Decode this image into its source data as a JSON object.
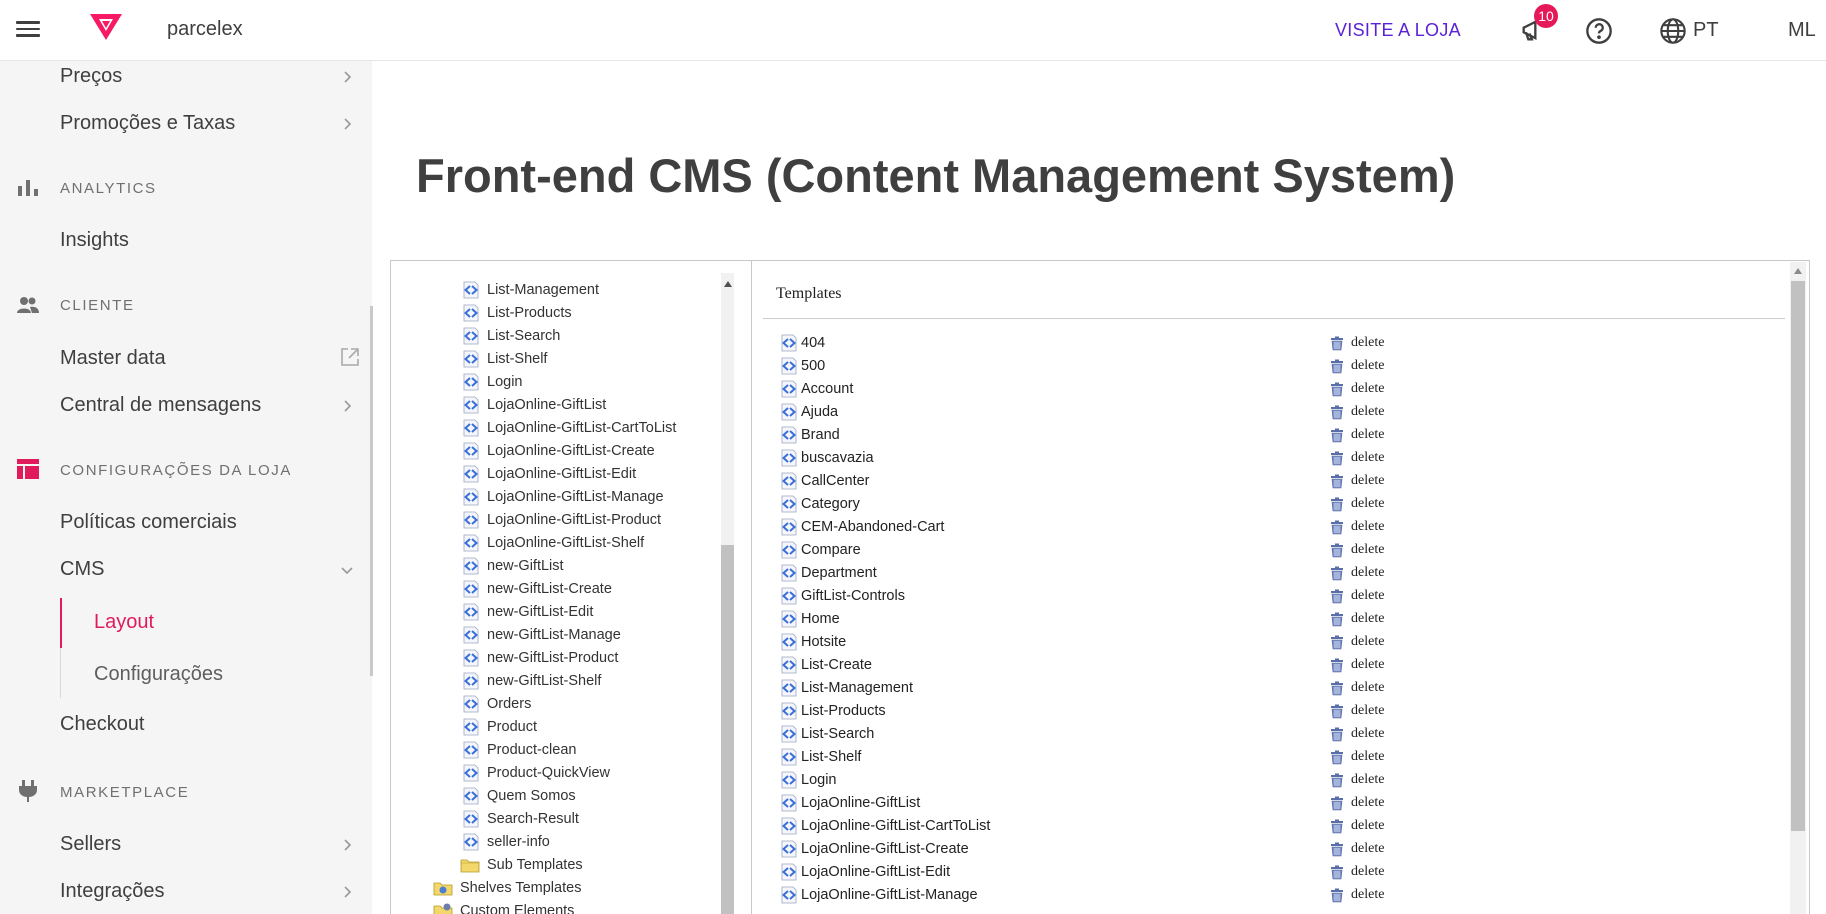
{
  "topbar": {
    "store_name": "parcelex",
    "visit_label": "VISITE A LOJA",
    "notification_count": "10",
    "language": "PT",
    "user_initials": "ML",
    "brand_color": "#f71963",
    "link_color": "#5a21d6"
  },
  "sidebar": {
    "items_top": [
      {
        "label": "Preços"
      },
      {
        "label": "Promoções e Taxas"
      }
    ],
    "sections": {
      "analytics": {
        "title": "ANALYTICS",
        "items": [
          "Insights"
        ]
      },
      "cliente": {
        "title": "CLIENTE",
        "items": [
          "Master data",
          "Central de mensagens"
        ]
      },
      "config": {
        "title": "CONFIGURAÇÕES DA LOJA",
        "items": [
          "Políticas comerciais",
          "CMS",
          "Checkout"
        ],
        "sub": [
          "Layout",
          "Configurações"
        ]
      },
      "marketplace": {
        "title": "MARKETPLACE",
        "items": [
          "Sellers",
          "Integrações"
        ]
      }
    },
    "active_color": "#e11a5c"
  },
  "main": {
    "title": "Front-end CMS (Content Management System)"
  },
  "tree": {
    "items": [
      "List-Management",
      "List-Products",
      "List-Search",
      "List-Shelf",
      "Login",
      "LojaOnline-GiftList",
      "LojaOnline-GiftList-CartToList",
      "LojaOnline-GiftList-Create",
      "LojaOnline-GiftList-Edit",
      "LojaOnline-GiftList-Manage",
      "LojaOnline-GiftList-Product",
      "LojaOnline-GiftList-Shelf",
      "new-GiftList",
      "new-GiftList-Create",
      "new-GiftList-Edit",
      "new-GiftList-Manage",
      "new-GiftList-Product",
      "new-GiftList-Shelf",
      "Orders",
      "Product",
      "Product-clean",
      "Product-QuickView",
      "Quem Somos",
      "Search-Result",
      "seller-info"
    ],
    "sub_templates": "Sub Templates",
    "shelves_templates": "Shelves Templates",
    "custom_elements": "Custom Elements"
  },
  "templates": {
    "header": "Templates",
    "delete_label": "delete",
    "rows": [
      "404",
      "500",
      "Account",
      "Ajuda",
      "Brand",
      "buscavazia",
      "CallCenter",
      "Category",
      "CEM-Abandoned-Cart",
      "Compare",
      "Department",
      "GiftList-Controls",
      "Home",
      "Hotsite",
      "List-Create",
      "List-Management",
      "List-Products",
      "List-Search",
      "List-Shelf",
      "Login",
      "LojaOnline-GiftList",
      "LojaOnline-GiftList-CartToList",
      "LojaOnline-GiftList-Create",
      "LojaOnline-GiftList-Edit",
      "LojaOnline-GiftList-Manage"
    ]
  }
}
